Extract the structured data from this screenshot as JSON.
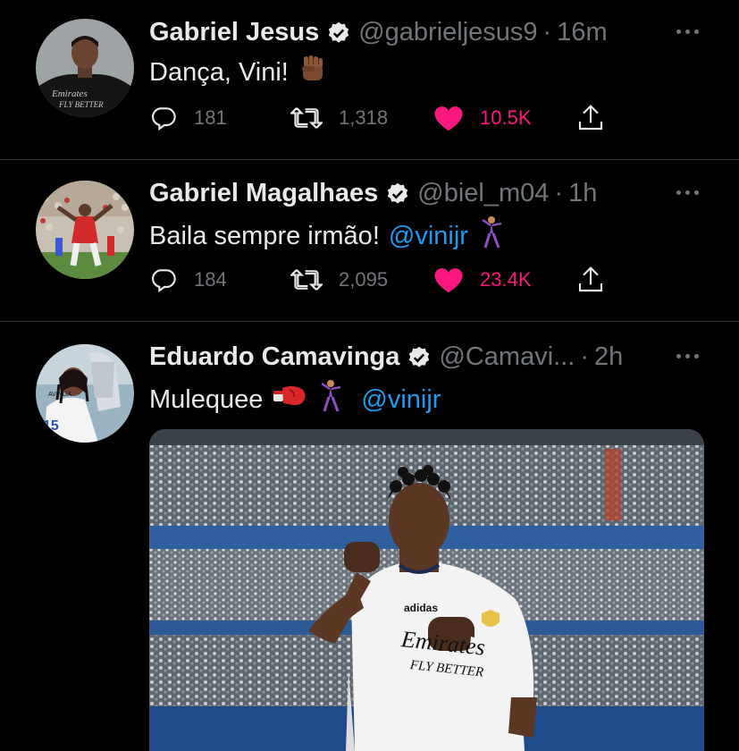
{
  "tweets": [
    {
      "name": "Gabriel Jesus",
      "handle": "@gabrieljesus9",
      "separator": "·",
      "time": "16m",
      "text": "Dança, Vini!",
      "replies": "181",
      "retweets": "1,318",
      "likes": "10.5K",
      "avatar_text": "Emirates FLY BETTER"
    },
    {
      "name": "Gabriel Magalhaes",
      "handle": "@biel_m04",
      "separator": "·",
      "time": "1h",
      "text": "Baila sempre irmão!",
      "mention": "@vinijr",
      "replies": "184",
      "retweets": "2,095",
      "likes": "23.4K"
    },
    {
      "name": "Eduardo Camavinga",
      "handle": "@Camavi...",
      "separator": "·",
      "time": "2h",
      "text": "Mulequee",
      "mention": "@vinijr",
      "media_text": {
        "logo": "Emirates",
        "tagline": "FLY BETTER"
      }
    }
  ],
  "colors": {
    "background": "#000000",
    "text": "#e7e9ea",
    "muted": "#71767b",
    "link": "#1d9bf0",
    "like": "#f91880",
    "divider": "#2f3336"
  },
  "icons": [
    "verified-badge-icon",
    "more-icon",
    "reply-icon",
    "retweet-icon",
    "heart-icon",
    "share-icon"
  ]
}
